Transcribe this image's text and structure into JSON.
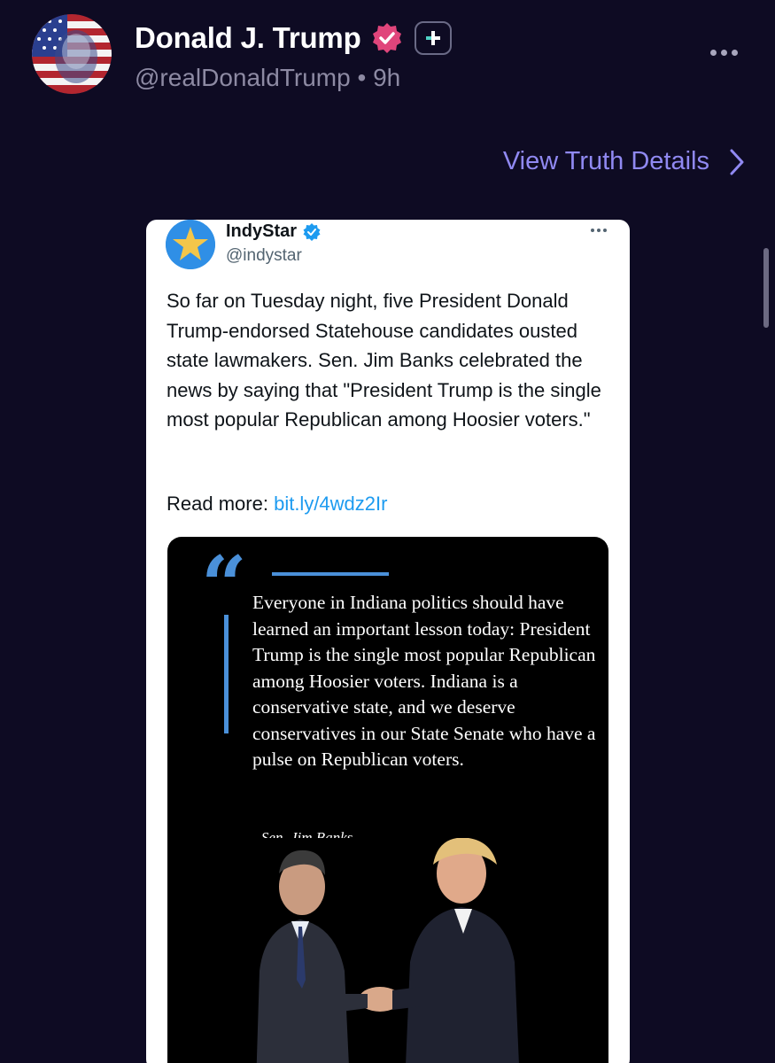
{
  "post": {
    "display_name": "Donald J. Trump",
    "handle": "@realDonaldTrump",
    "separator": "•",
    "time_ago": "9h",
    "view_details_label": "View Truth Details"
  },
  "embedded_tweet": {
    "name": "IndyStar",
    "handle": "@indystar",
    "body": "So far on Tuesday night, five President Donald Trump-endorsed Statehouse candidates ousted state lawmakers. Sen. Jim Banks celebrated the news by saying that \"President Trump is the single most popular Republican among Hoosier voters.\"",
    "read_more_label": "Read more:",
    "link_text": "bit.ly/4wdz2Ir",
    "quote_image": {
      "quote": "Everyone in Indiana politics should have learned an important lesson today: President Trump is the single most popular Republican among Hoosier voters. Indiana is a conservative state, and we deserve conservatives in our State Senate who have a pulse on Republican voters.",
      "attribution": "- Sen. Jim Banks"
    }
  },
  "colors": {
    "background": "#0e0b23",
    "accent_link": "#9089f2",
    "verified_badge": "#e0457b",
    "twitter_link": "#1d9bf0",
    "quote_accent": "#4a90d9"
  },
  "icons": {
    "verified": "verified-badge-icon",
    "plus": "plus-badge-icon",
    "more": "more-dots-icon",
    "chevron": "chevron-right-icon",
    "tweet_verified": "blue-check-icon",
    "tweet_more": "more-dots-icon"
  }
}
